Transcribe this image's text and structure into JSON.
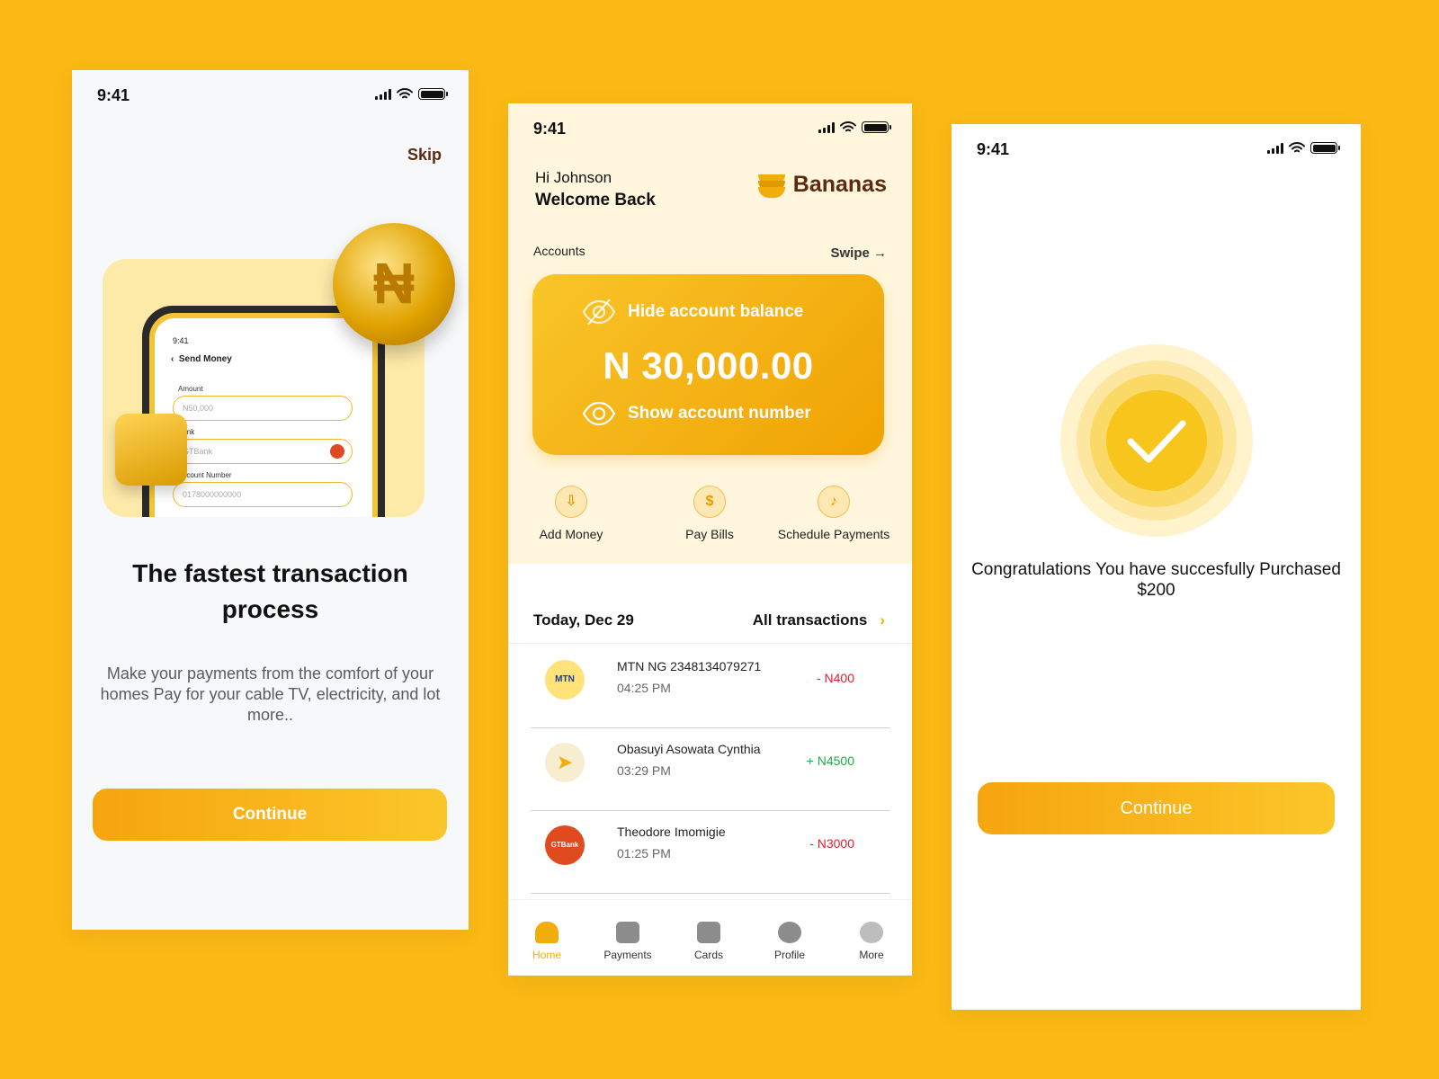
{
  "status_time": "9:41",
  "onboarding": {
    "skip_label": "Skip",
    "mock": {
      "time": "9:41",
      "screen_title": "Send Money",
      "amount_label": "Amount",
      "amount_value": "N50,000",
      "bank_label": "Bank",
      "bank_value": "GTBank",
      "account_label": "Account Number",
      "account_value": "0178000000000"
    },
    "title": "The fastest transaction process",
    "description": "Make your payments from the comfort of your homes Pay for your cable TV, electricity,  and lot more..",
    "continue_label": "Continue"
  },
  "home": {
    "greeting": "Hi Johnson",
    "welcome": "Welcome Back",
    "brand": "Bananas",
    "accounts_label": "Accounts",
    "swipe_label": "Swipe →",
    "card": {
      "hide_label": "Hide account balance",
      "balance": "N 30,000.00",
      "show_label": "Show account number"
    },
    "quick_actions": [
      {
        "label": "Add Money"
      },
      {
        "label": "Pay Bills"
      },
      {
        "label": "Schedule Payments"
      }
    ],
    "date_label": "Today, Dec 29",
    "all_transactions_label": "All transactions",
    "transactions": [
      {
        "name": "MTN NG 2348134079271",
        "time": "04:25 PM",
        "amount": "- N400",
        "avatar": "MTN"
      },
      {
        "name": "Obasuyi Asowata Cynthia",
        "time": "03:29 PM",
        "amount": "+ N4500",
        "avatar": "➤"
      },
      {
        "name": "Theodore Imomigie",
        "time": "01:25 PM",
        "amount": "- N3000",
        "avatar": "GTBank"
      }
    ],
    "tabs": [
      {
        "label": "Home"
      },
      {
        "label": "Payments"
      },
      {
        "label": "Cards"
      },
      {
        "label": "Profile"
      },
      {
        "label": "More"
      }
    ]
  },
  "success": {
    "message": "Congratulations You have succesfully Purchased $200",
    "continue_label": "Continue"
  }
}
